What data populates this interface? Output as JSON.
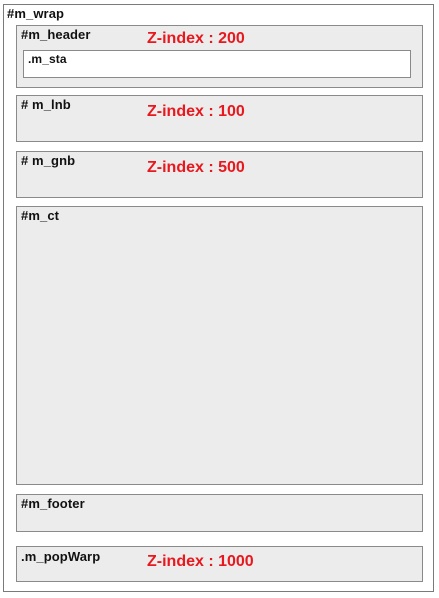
{
  "wrap": {
    "label": "#m_wrap"
  },
  "header": {
    "label": "#m_header",
    "zindex": "Z-index : 200",
    "sta": {
      "label": ".m_sta"
    }
  },
  "lnb": {
    "label": "# m_lnb",
    "zindex": "Z-index : 100"
  },
  "gnb": {
    "label": "# m_gnb",
    "zindex": "Z-index : 500"
  },
  "ct": {
    "label": "#m_ct"
  },
  "footer": {
    "label": "#m_footer"
  },
  "popwarp": {
    "label": ".m_popWarp",
    "zindex": "Z-index : 1000"
  },
  "colors": {
    "zindex_text": "#e8181e",
    "box_fill": "#ececec",
    "border": "#8a8a8a"
  }
}
